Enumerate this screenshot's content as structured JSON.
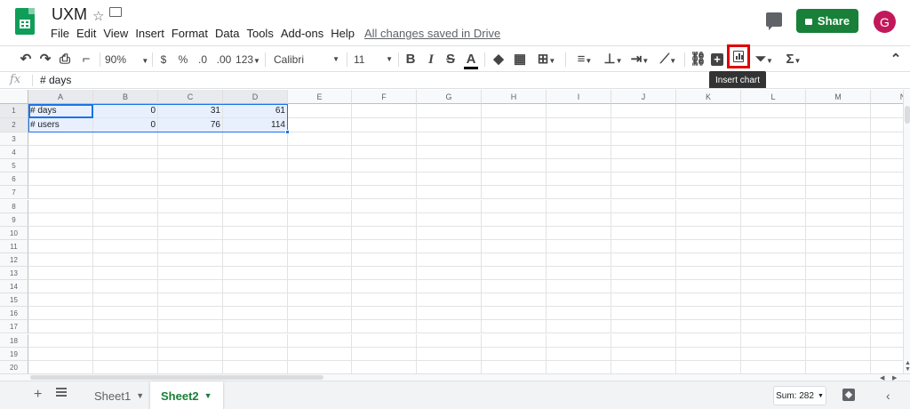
{
  "header": {
    "title": "UXM",
    "star_icon": "☆",
    "folder_icon": "▭",
    "menu": [
      "File",
      "Edit",
      "View",
      "Insert",
      "Format",
      "Data",
      "Tools",
      "Add-ons",
      "Help"
    ],
    "save_status": "All changes saved in Drive",
    "share_label": "Share",
    "avatar_initial": "G"
  },
  "toolbar": {
    "zoom": "90%",
    "currency": "$",
    "percent": "%",
    "decrease_decimal": ".0",
    "increase_decimal": ".00",
    "more_formats": "123",
    "font": "Calibri",
    "font_size": "11",
    "bold": "B",
    "italic": "I",
    "strikethrough": "S",
    "text_color": "A",
    "function_icon": "Σ",
    "tooltip": "Insert chart"
  },
  "formula_bar": {
    "fx_label": "fx",
    "content": "# days"
  },
  "grid": {
    "columns": [
      "A",
      "B",
      "C",
      "D",
      "E",
      "F",
      "G",
      "H",
      "I",
      "J",
      "K",
      "L",
      "M",
      "N"
    ],
    "rows": [
      "1",
      "2",
      "3",
      "4",
      "5",
      "6",
      "7",
      "8",
      "9",
      "10",
      "11",
      "12",
      "13",
      "14",
      "15",
      "16",
      "17",
      "18",
      "19",
      "20"
    ],
    "cells": {
      "A1": "# days",
      "B1": "0",
      "C1": "31",
      "D1": "61",
      "A2": "# users",
      "B2": "0",
      "C2": "76",
      "D2": "114"
    }
  },
  "bottom_bar": {
    "add_sheet": "+",
    "sheets": [
      {
        "name": "Sheet1",
        "active": false
      },
      {
        "name": "Sheet2",
        "active": true
      }
    ],
    "sum_label": "Sum: 282"
  },
  "colors": {
    "brand_green": "#0f9d58",
    "share_green": "#188038",
    "selection_blue": "#1a73e8",
    "highlight_red": "#e00000",
    "avatar": "#c2185b"
  }
}
